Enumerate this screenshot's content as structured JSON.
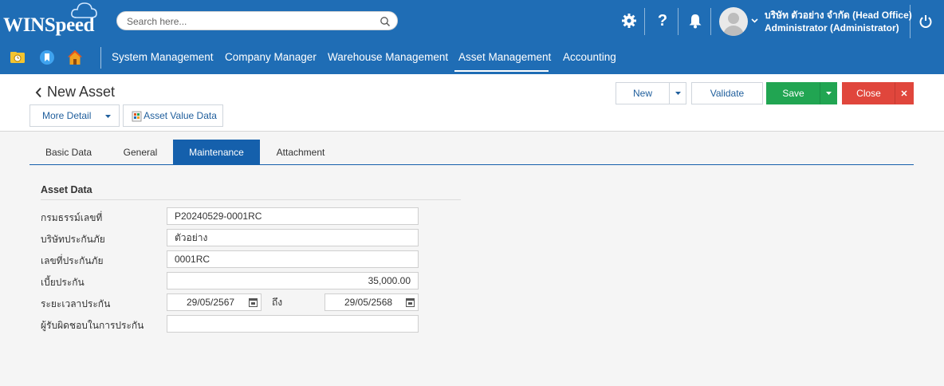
{
  "app": {
    "logo": "WINSpeed"
  },
  "search": {
    "placeholder": "Search here..."
  },
  "user": {
    "company": "บริษัท ตัวอย่าง จำกัด (Head Office)",
    "name": "Administrator (Administrator)"
  },
  "menu": {
    "items": [
      "System Management",
      "Company Manager",
      "Warehouse Management",
      "Asset Management",
      "Accounting"
    ],
    "active": "Asset Management"
  },
  "page": {
    "title": "New Asset",
    "more_detail": "More Detail",
    "asset_value_data": "Asset Value Data"
  },
  "actions": {
    "new": "New",
    "validate": "Validate",
    "save": "Save",
    "close": "Close"
  },
  "tabs": [
    "Basic Data",
    "General",
    "Maintenance",
    "Attachment"
  ],
  "active_tab": "Maintenance",
  "form": {
    "section_title": "Asset Data",
    "fields": [
      {
        "label": "กรมธรรม์เลขที่",
        "value": "P20240529-0001RC"
      },
      {
        "label": "บริษัทประกันภัย",
        "value": "ตัวอย่าง"
      },
      {
        "label": "เลขที่ประกันภัย",
        "value": "0001RC"
      },
      {
        "label": "เบี้ยประกัน",
        "value": "35,000.00"
      },
      {
        "label": "ระยะเวลาประกัน",
        "value_from": "29/05/2567",
        "to_label": "ถึง",
        "value_to": "29/05/2568"
      },
      {
        "label": "ผู้รับผิดชอบในการประกัน",
        "value": ""
      }
    ]
  },
  "colors": {
    "header": "#1f6db5",
    "active_tab": "#1560ac",
    "save": "#21a552",
    "close": "#e0463c"
  }
}
